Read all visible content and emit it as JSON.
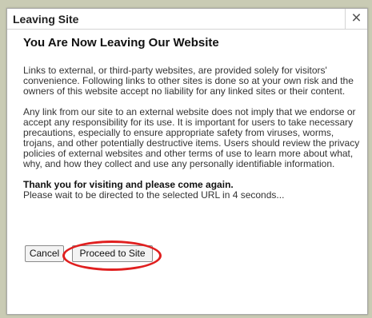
{
  "dialog": {
    "title": "Leaving Site",
    "close_icon": "×",
    "heading": "You Are Now Leaving Our Website",
    "paragraph1": "Links to external, or third-party websites, are provided solely for visitors' convenience. Following links to other sites is done so at your own risk and the owners of this website accept no liability for any linked sites or their content.",
    "paragraph2": "Any link from our site to an external website does not imply that we endorse or accept any responsibility for its use. It is important for users to take necessary precautions, especially to ensure appropriate safety from viruses, worms, trojans, and other potentially destructive items. Users should review the privacy policies of external websites and other terms of use to learn more about what, why, and how they collect and use any personally identifiable information.",
    "thanks": "Thank you for visiting and please come again.",
    "redirect_notice": "Please wait to be directed to the selected URL in 4 seconds..."
  },
  "buttons": {
    "cancel_label": "Cancel",
    "proceed_label": "Proceed to Site"
  },
  "colors": {
    "highlight_ring": "#e01f1f",
    "backdrop": "#c9cbb4"
  }
}
